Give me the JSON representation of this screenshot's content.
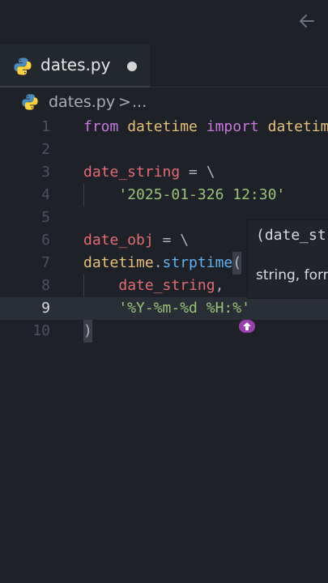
{
  "tab": {
    "filename": "dates.py",
    "icon": "python-icon",
    "modified": true
  },
  "breadcrumb": {
    "file": "dates.py",
    "separator": ">",
    "more": "..."
  },
  "code_lines": [
    {
      "num": "1"
    },
    {
      "num": "2"
    },
    {
      "num": "3"
    },
    {
      "num": "4"
    },
    {
      "num": "5"
    },
    {
      "num": "6"
    },
    {
      "num": "7"
    },
    {
      "num": "8"
    },
    {
      "num": "9"
    },
    {
      "num": "10"
    }
  ],
  "code": {
    "l1_from": "from",
    "l1_mod": "datetime",
    "l1_import": "import",
    "l1_cls": "datetime",
    "l3_var": "date_string",
    "l3_rest": " = \\",
    "l4_str": "'2025-01-326 12:30'",
    "l6_var": "date_obj",
    "l6_rest": " = \\",
    "l7_cls": "datetime",
    "l7_dot": ".",
    "l7_fn": "strptime",
    "l7_paren": "(",
    "l8_var": "date_string",
    "l8_comma": ",",
    "l9_str": "'%Y-%m-%d %H:%'",
    "l10_paren": ")"
  },
  "tooltip": {
    "signature": "(date_string",
    "params": "string, format"
  },
  "active_line": "9",
  "colors": {
    "background": "#1e2127",
    "keyword": "#c678dd",
    "class": "#e5c07b",
    "variable": "#e06c75",
    "function": "#61afef",
    "string": "#98c379",
    "cursor_badge": "#9b3fb0"
  }
}
